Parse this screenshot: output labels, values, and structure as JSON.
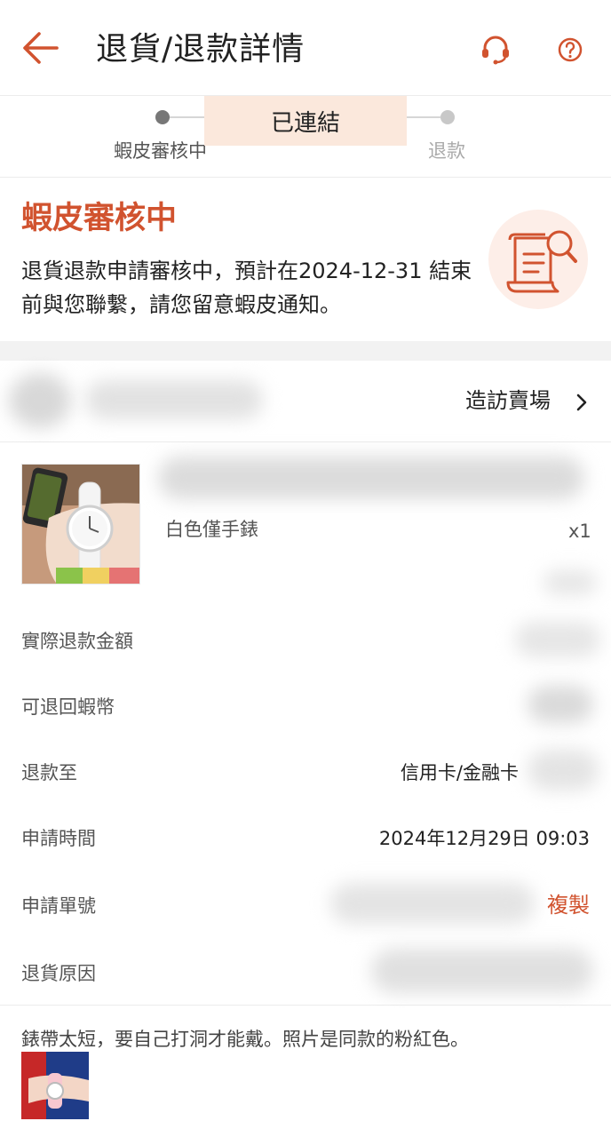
{
  "header": {
    "title": "退貨/退款詳情",
    "back_icon": "arrow-left-icon",
    "support_icon": "headset-icon",
    "help_icon": "question-circle-icon",
    "accent_color": "#d1532f"
  },
  "stepper": {
    "steps": [
      {
        "label": "蝦皮審核中",
        "state": "active"
      },
      {
        "label": "退款",
        "state": "pending"
      }
    ],
    "toast": "已連結"
  },
  "status": {
    "title": "蝦皮審核中",
    "description": "退貨退款申請審核中，預計在2024-12-31 結束前與您聯繫，請您留意蝦皮通知。",
    "illustration_icon": "document-search-icon"
  },
  "shop": {
    "visit_label": "造訪賣場"
  },
  "product": {
    "variant": "白色僅手錶",
    "quantity": "x1"
  },
  "details": {
    "refund_amount_label": "實際退款金額",
    "coins_label": "可退回蝦幣",
    "refund_to_label": "退款至",
    "refund_to_value": "信用卡/金融卡",
    "request_time_label": "申請時間",
    "request_time_value": "2024年12月29日 09:03",
    "request_no_label": "申請單號",
    "copy_label": "複製",
    "reason_label": "退貨原因"
  },
  "reason": {
    "text": "錶帶太短，要自己打洞才能戴。照片是同款的粉紅色。"
  }
}
